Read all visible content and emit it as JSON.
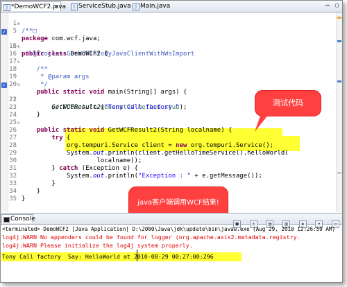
{
  "tabs": [
    {
      "label": "*DemoWCF2.java"
    },
    {
      "label": "ServiceStub.java"
    },
    {
      "label": "Main.java"
    }
  ],
  "window_controls": "▭ ▢",
  "code_lines": [
    {
      "num": "1",
      "text": "/**□"
    },
    {
      "num": "5",
      "text": "package com.wcf.java;"
    },
    {
      "num": "6",
      "text": " * @Project:GetWCFInfoByJavaClientWithWsImport"
    },
    {
      "num": "15",
      "text": "public class DemoWCF2 {"
    },
    {
      "num": "16",
      "text": ""
    },
    {
      "num": "17",
      "text": "    /**"
    },
    {
      "num": "18",
      "text": "     * @param args"
    },
    {
      "num": "19",
      "text": "     */"
    },
    {
      "num": "20",
      "text": "    public static void main(String[] args) {"
    },
    {
      "num": "21",
      "text": "        // TODO Auto-generated method stub"
    },
    {
      "num": "22",
      "text": "        GetWCFResult2(\"Tony Call factory \");"
    },
    {
      "num": "23",
      "text": "    }"
    },
    {
      "num": "24",
      "text": ""
    },
    {
      "num": "25",
      "text": "    public static void GetWCFResult2(String localname) {"
    },
    {
      "num": "26",
      "text": "        try {"
    },
    {
      "num": "27",
      "text": "            org.tempuri.Service client = new org.tempuri.Service();"
    },
    {
      "num": "28",
      "text": "            System.out.println(client.getHelloTimeService().helloWorld("
    },
    {
      "num": "29",
      "text": "                    localname));"
    },
    {
      "num": "30",
      "text": "        } catch (Exception e) {"
    },
    {
      "num": "31",
      "text": "            System.out.println(\"Exception : \" + e.getMessage());"
    },
    {
      "num": "32",
      "text": "        }"
    },
    {
      "num": "33",
      "text": "    }"
    },
    {
      "num": "34",
      "text": "}"
    },
    {
      "num": "35",
      "text": ""
    }
  ],
  "callouts": {
    "test_code": "测试代码",
    "java_client": "java客户端调用WCF结果!"
  },
  "console": {
    "tab_label": "Console",
    "terminated": "<terminated> DemoWCF2 [Java Application] D:\\2000\\Java\\jdk\\update\\bin\\javaw.exe (Aug 29, 2010 12:26:59 AM)",
    "lines": [
      "log4j:WARN No appenders could be found for logger (org.apache.axis2.metadata.registry.",
      "log4j:WARN Please initialize the log4j system properly.",
      "Tony Call factory  Say: HelloWorld at 2010-08-29 00:27:00:296"
    ]
  },
  "colors": {
    "keyword": "#7f0055",
    "comment": "#3f7f5f",
    "string": "#2a00ff",
    "highlight": "#ffff33",
    "callout": "#ff4040",
    "error_text": "#e00000"
  }
}
